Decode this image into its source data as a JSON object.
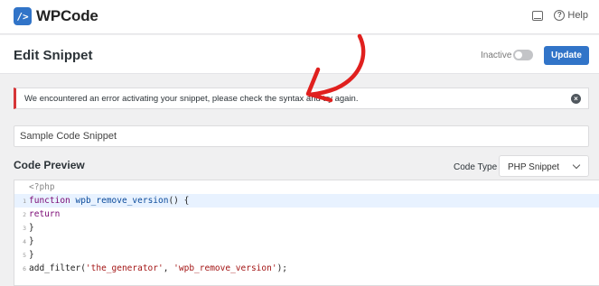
{
  "app": {
    "name": "WPCode"
  },
  "topbar": {
    "help_label": "Help"
  },
  "header": {
    "title": "Edit Snippet",
    "status": "Inactive",
    "update_label": "Update"
  },
  "notice": {
    "text": "We encountered an error activating your snippet, please check the syntax and try again."
  },
  "snippet": {
    "title_value": "Sample Code Snippet"
  },
  "preview": {
    "title": "Code Preview",
    "code_type_label": "Code Type",
    "code_type_value": "PHP Snippet",
    "lines": [
      {
        "num": "",
        "text": "<?php"
      },
      {
        "num": "1",
        "kw": "function",
        "fn": "wpb_remove_version",
        "rest": "() {"
      },
      {
        "num": "2",
        "kw": "return",
        "rest": ""
      },
      {
        "num": "3",
        "rest": "}"
      },
      {
        "num": "4",
        "rest": "}"
      },
      {
        "num": "5",
        "rest": "}"
      },
      {
        "num": "6",
        "pre": "add_filter(",
        "s1": "'the_generator'",
        "mid": ", ",
        "s2": "'wpb_remove_version'",
        "post": ");"
      }
    ]
  },
  "colors": {
    "accent": "#3174c8",
    "error": "#d63638",
    "annotation_arrow": "#e0201e"
  },
  "icons": [
    "inbox-icon",
    "help-icon",
    "dismiss-icon",
    "chevron-down-icon"
  ]
}
